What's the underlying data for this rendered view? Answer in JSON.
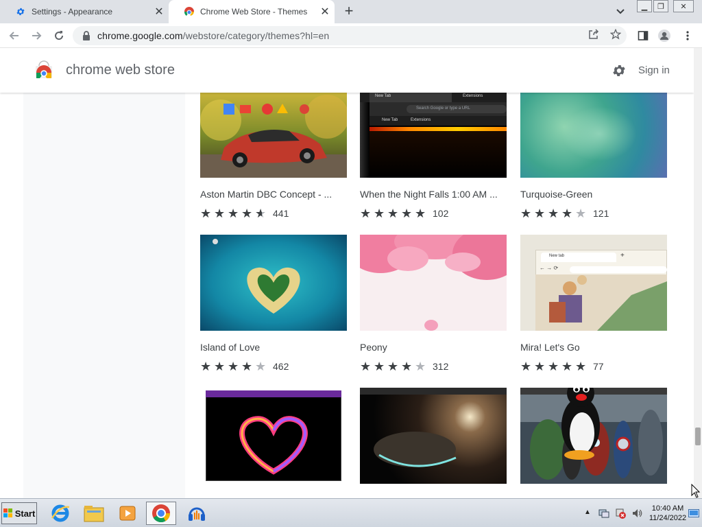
{
  "browser": {
    "tabs": [
      {
        "title": "Settings - Appearance",
        "active": false
      },
      {
        "title": "Chrome Web Store - Themes",
        "active": true
      }
    ],
    "url_host": "chrome.google.com",
    "url_path": "/webstore/category/themes?hl=en"
  },
  "store": {
    "name": "chrome web store",
    "sign_in": "Sign in"
  },
  "themes": [
    {
      "name": "Aston Martin DBC Concept - ...",
      "rating": 4.5,
      "count": "441"
    },
    {
      "name": "When the Night Falls 1:00 AM ...",
      "rating": 5,
      "count": "102"
    },
    {
      "name": "Turquoise-Green",
      "rating": 4,
      "count": "121"
    },
    {
      "name": "Island of Love",
      "rating": 4,
      "count": "462"
    },
    {
      "name": "Peony",
      "rating": 4,
      "count": "312"
    },
    {
      "name": "Mira! Let's Go",
      "rating": 5,
      "count": "77"
    },
    {
      "name": "",
      "rating": null,
      "count": ""
    },
    {
      "name": "",
      "rating": null,
      "count": ""
    },
    {
      "name": "",
      "rating": null,
      "count": ""
    }
  ],
  "thumb_text": {
    "night_tab": "New Tab",
    "night_ext": "Extensions",
    "night_search": "Search Google or type a URL",
    "night_sc1": "New Tab",
    "night_sc2": "Extensions",
    "mira_tab": "New tab"
  },
  "taskbar": {
    "start": "Start",
    "time": "10:40 AM",
    "date": "11/24/2022"
  },
  "colors": {
    "accent": "#1a73e8",
    "text": "#3c4043",
    "muted": "#5f6368"
  }
}
